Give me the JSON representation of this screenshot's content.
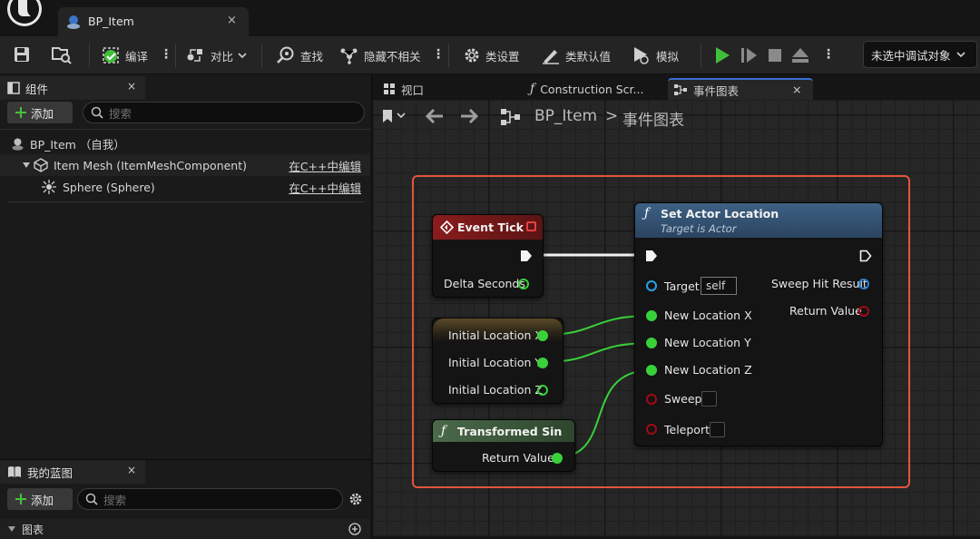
{
  "title_bar": {
    "tab_label": "BP_Item",
    "tab_close": "×"
  },
  "toolbar": {
    "compile_label": "编译",
    "diff_label": "对比",
    "find_label": "查找",
    "hide_unrelated_label": "隐藏不相关",
    "class_settings_label": "类设置",
    "class_defaults_label": "类默认值",
    "simulate_label": "模拟",
    "debug_object": "未选中调试对象"
  },
  "components_panel": {
    "title": "组件",
    "close": "×",
    "add_label": "添加",
    "search_placeholder": "搜索",
    "tree": [
      {
        "label": "BP_Item （自我）",
        "link": ""
      },
      {
        "label": "Item Mesh (ItemMeshComponent)",
        "link": "在C++中编辑"
      },
      {
        "label": "Sphere (Sphere)",
        "link": "在C++中编辑"
      }
    ]
  },
  "my_blueprint_panel": {
    "title": "我的蓝图",
    "close": "×",
    "add_label": "添加",
    "search_placeholder": "搜索",
    "section_graphs": "图表"
  },
  "editor_tabs": [
    {
      "label": "视口"
    },
    {
      "label": "Construction Scr..."
    },
    {
      "label": "事件图表",
      "close": "×"
    }
  ],
  "breadcrumb": {
    "blueprint": "BP_Item",
    "separator": ">",
    "graph": "事件图表"
  },
  "nodes": {
    "event_tick": {
      "title": "Event Tick",
      "pin_delta": "Delta Seconds",
      "header_color": "#7a1818"
    },
    "initial_location": {
      "pin_x": "Initial Location X",
      "pin_y": "Initial Location Y",
      "pin_z": "Initial Location Z"
    },
    "transformed_sin": {
      "title": "Transformed Sin",
      "pin_return": "Return Value",
      "header_color": "#3f5c3f"
    },
    "set_actor_location": {
      "title": "Set Actor Location",
      "subtitle": "Target is Actor",
      "header_color": "#3a5a78",
      "pin_target": "Target",
      "target_value": "self",
      "pin_new_x": "New Location X",
      "pin_new_y": "New Location Y",
      "pin_new_z": "New Location Z",
      "pin_sweep": "Sweep",
      "pin_teleport": "Teleport",
      "out_sweep_hit": "Sweep Hit Result",
      "out_return": "Return Value"
    }
  },
  "colors": {
    "float_pin": "#38d13a",
    "object_pin": "#2aa3e6",
    "bool_pin": "#a10a14",
    "selection_box": "#e2553a"
  }
}
